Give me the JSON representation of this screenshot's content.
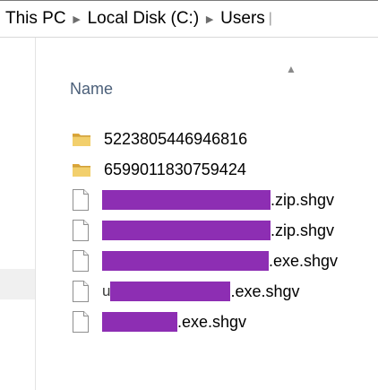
{
  "address_bar": {
    "crumbs": [
      "This PC",
      "Local Disk (C:)",
      "Users"
    ],
    "separator_icon": "chevron-right-icon"
  },
  "list_header": {
    "name_label": "Name",
    "sort": "ascending"
  },
  "files": [
    {
      "type": "folder",
      "name": "5223805446946816"
    },
    {
      "type": "folder",
      "name": "6599011830759424"
    },
    {
      "type": "file",
      "redacted": true,
      "suffix": ".zip.shgv"
    },
    {
      "type": "file",
      "redacted": true,
      "suffix": ".zip.shgv"
    },
    {
      "type": "file",
      "redacted": true,
      "suffix": ".exe.shgv"
    },
    {
      "type": "file",
      "redacted": true,
      "visible_prefix": "u",
      "suffix": ".exe.shgv"
    },
    {
      "type": "file",
      "redacted": true,
      "suffix": ".exe.shgv"
    }
  ],
  "colors": {
    "redaction": "#8d2eb3",
    "header_text": "#4c607a",
    "folder": "#e8c158",
    "hover_row": "#f0f0f0"
  }
}
